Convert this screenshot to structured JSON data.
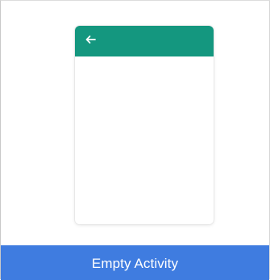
{
  "template": {
    "label": "Empty Activity",
    "selected": true
  },
  "preview": {
    "app_bar_icon": "back-arrow-icon"
  },
  "colors": {
    "app_bar": "#14977f",
    "caption_background": "#3f7ce0",
    "caption_text": "#ffffff",
    "icon": "#ffffff"
  }
}
